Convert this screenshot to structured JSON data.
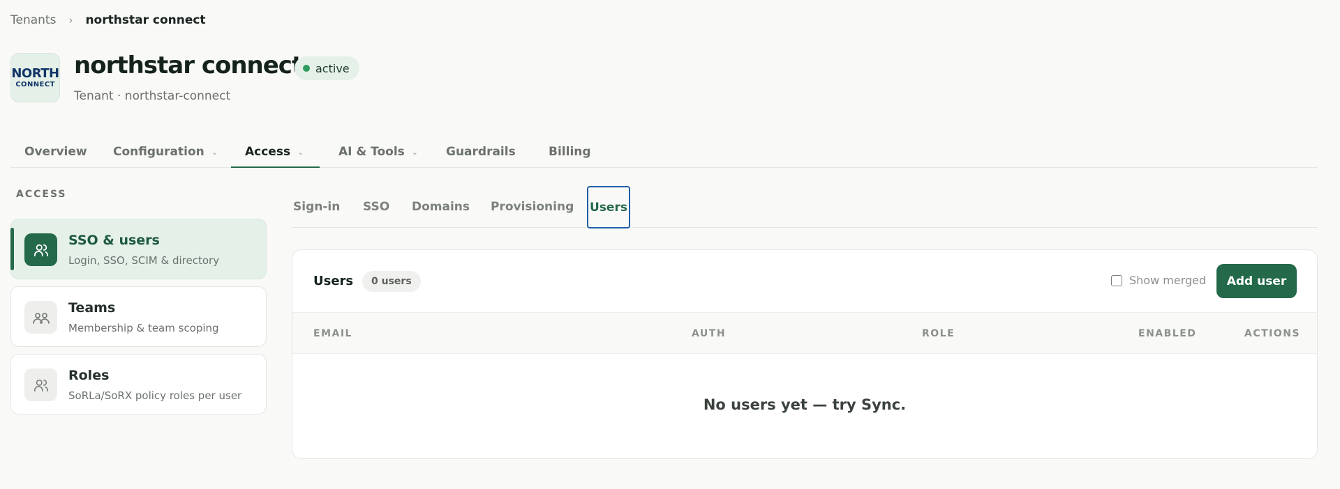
{
  "breadcrumb": {
    "parent": "Tenants",
    "separator": "›",
    "current": "northstar connect"
  },
  "tenant": {
    "logo_top": "NORTH",
    "logo_bottom": "CONNECT",
    "name": "northstar connect",
    "status": "active",
    "subtitle": "Tenant · northstar-connect"
  },
  "main_tabs": [
    {
      "label": "Overview"
    },
    {
      "label": "Configuration"
    },
    {
      "label": "Access"
    },
    {
      "label": "AI & Tools"
    },
    {
      "label": "Guardrails"
    },
    {
      "label": "Billing"
    }
  ],
  "sidebar": {
    "heading": "ACCESS",
    "items": [
      {
        "title": "SSO & users",
        "desc": "Login, SSO, SCIM & directory",
        "icon": "users-icon"
      },
      {
        "title": "Teams",
        "desc": "Membership & team scoping",
        "icon": "team-icon"
      },
      {
        "title": "Roles",
        "desc": "SoRLa/SoRX policy roles per user",
        "icon": "roles-icon"
      }
    ]
  },
  "sub_tabs": [
    {
      "label": "Sign-in"
    },
    {
      "label": "SSO"
    },
    {
      "label": "Domains"
    },
    {
      "label": "Provisioning"
    },
    {
      "label": "Users"
    }
  ],
  "users_panel": {
    "title": "Users",
    "count": "0 users",
    "show_merged_label": "Show merged",
    "add_button": "Add user",
    "columns": [
      "EMAIL",
      "AUTH",
      "ROLE",
      "ENABLED",
      "ACTIONS"
    ],
    "empty_message": "No users yet — try Sync."
  },
  "colors": {
    "accent": "#23694a",
    "focus": "#1f5fa5",
    "status": "#2e9a5c"
  }
}
